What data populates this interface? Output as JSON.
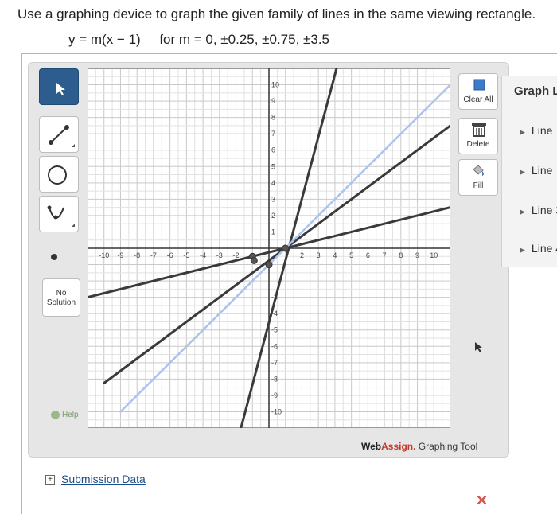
{
  "question": {
    "text": "Use a graphing device to graph the given family of lines in the same viewing rectangle.",
    "equation": "y = m(x − 1)",
    "condition": "for m = 0, ±0.25, ±0.75, ±3.5"
  },
  "left_toolbar": {
    "tools": [
      {
        "icon": "pointer-icon",
        "selected": true
      },
      {
        "icon": "line-tool-icon",
        "selected": false
      },
      {
        "icon": "circle-tool-icon",
        "selected": false
      },
      {
        "icon": "parabola-tool-icon",
        "selected": false
      },
      {
        "icon": "point-tool-icon",
        "selected": false
      }
    ],
    "no_solution_line1": "No",
    "no_solution_line2": "Solution",
    "help_label": "Help"
  },
  "right_toolbar": {
    "clear_all": "Clear All",
    "delete": "Delete",
    "fill": "Fill"
  },
  "graph_layers": {
    "title": "Graph L",
    "items": [
      "Line",
      "Line",
      "Line 3",
      "Line 4"
    ]
  },
  "branding": {
    "web": "Web",
    "assign": "Assign.",
    "tool_name": " Graphing Tool"
  },
  "submission": {
    "label": "Submission Data"
  },
  "status": {
    "x_mark": "✕"
  },
  "colors": {
    "selected_tool": "#2d5d8f",
    "drawn_line": "#3a3a3a",
    "highlighted_line": "#a9c4ee",
    "grid_major": "#c9c9c9",
    "grid_minor": "#e2e2e2",
    "webassign_accent": "#c0392b"
  },
  "chart_data": {
    "type": "line",
    "xlim": [
      -11,
      11
    ],
    "ylim": [
      -11,
      11
    ],
    "x_ticks": [
      -10,
      -9,
      -8,
      -7,
      -6,
      -5,
      -4,
      -3,
      -2,
      2,
      3,
      4,
      5,
      6,
      7,
      8,
      9,
      10
    ],
    "y_ticks": [
      10,
      9,
      8,
      7,
      6,
      5,
      4,
      3,
      2,
      1,
      -3,
      -4,
      -5,
      -6,
      -7,
      -8,
      -9,
      -10
    ],
    "grid": true,
    "series": [
      {
        "slope": 3.5,
        "points": [
          [
            -1.7,
            -11
          ],
          [
            4.1,
            11
          ]
        ],
        "highlight": false
      },
      {
        "slope": 0.75,
        "points": [
          [
            -10,
            -8.25
          ],
          [
            11,
            7.5
          ]
        ],
        "highlight": false
      },
      {
        "slope": 0.25,
        "points": [
          [
            -11,
            -3
          ],
          [
            11,
            2.5
          ]
        ],
        "highlight": false
      },
      {
        "slope": 1,
        "points": [
          [
            -9,
            -10
          ],
          [
            11,
            10
          ]
        ],
        "highlight": true
      }
    ],
    "points": [
      [
        1,
        0
      ],
      [
        -1,
        -0.5
      ],
      [
        0,
        -1
      ],
      [
        -0.9,
        -0.75
      ]
    ]
  }
}
